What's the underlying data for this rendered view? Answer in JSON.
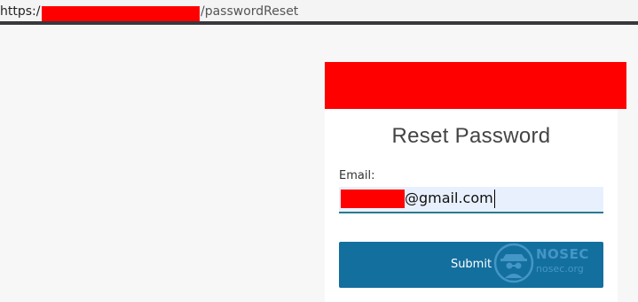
{
  "browser": {
    "url_scheme": "https:/",
    "url_path": "/passwordReset"
  },
  "form": {
    "title": "Reset Password",
    "email_label": "Email:",
    "email_value_visible": "@gmail.com",
    "submit_label": "Submit"
  },
  "watermark": {
    "brand": "NOSEC",
    "domain": "nosec.org"
  },
  "colors": {
    "redaction": "#ff0000",
    "button": "#136f9e",
    "input_bg": "#e8f0fe",
    "watermark": "#6db7e8"
  }
}
